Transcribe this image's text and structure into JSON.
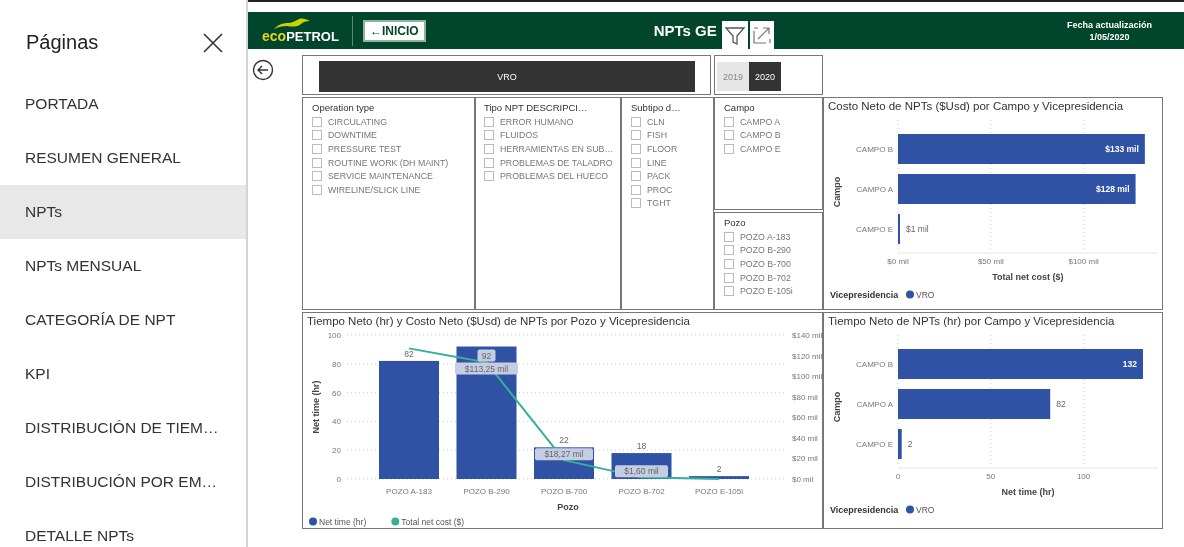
{
  "sidebar": {
    "title": "Páginas",
    "items": [
      {
        "label": "PORTADA",
        "selected": false
      },
      {
        "label": "RESUMEN GENERAL",
        "selected": false
      },
      {
        "label": "NPTs",
        "selected": true
      },
      {
        "label": "NPTs MENSUAL",
        "selected": false
      },
      {
        "label": "CATEGORÍA DE NPT",
        "selected": false
      },
      {
        "label": "KPI",
        "selected": false
      },
      {
        "label": "DISTRIBUCIÓN DE TIEM…",
        "selected": false
      },
      {
        "label": "DISTRIBUCIÓN POR EM…",
        "selected": false
      },
      {
        "label": "DETALLE NPTs",
        "selected": false
      }
    ]
  },
  "header": {
    "logo": {
      "lead": "eco",
      "rest": "PETROL"
    },
    "home_button": "←INICIO",
    "title": "NPTs GE",
    "update_label": "Fecha actualización",
    "update_date": "1/05/2020"
  },
  "vp_slicer": {
    "items": [
      {
        "label": "VRO",
        "selected": true
      }
    ]
  },
  "year_slicer": {
    "items": [
      {
        "label": "2019",
        "selected": false
      },
      {
        "label": "2020",
        "selected": true
      }
    ]
  },
  "slicers": [
    {
      "title": "Operation type",
      "items": [
        {
          "label": "CIRCULATING",
          "checked": false
        },
        {
          "label": "DOWNTIME",
          "checked": false
        },
        {
          "label": "PRESSURE TEST",
          "checked": false
        },
        {
          "label": "ROUTINE WORK (DH MAINT)",
          "checked": false
        },
        {
          "label": "SERVICE MAINTENANCE",
          "checked": false
        },
        {
          "label": "WIRELINE/SLICK LINE",
          "checked": false
        }
      ]
    },
    {
      "title": "Tipo NPT DESCRIPCI…",
      "items": [
        {
          "label": "ERROR HUMANO",
          "checked": false
        },
        {
          "label": "FLUIDOS",
          "checked": false
        },
        {
          "label": "HERRAMIENTAS EN SUB…",
          "checked": false
        },
        {
          "label": "PROBLEMAS DE TALADRO",
          "checked": false
        },
        {
          "label": "PROBLEMAS DEL HUECO",
          "checked": false
        }
      ]
    },
    {
      "title": "Subtipo d…",
      "items": [
        {
          "label": "CLN",
          "checked": false
        },
        {
          "label": "FISH",
          "checked": false
        },
        {
          "label": "FLOOR",
          "checked": false
        },
        {
          "label": "LINE",
          "checked": false
        },
        {
          "label": "PACK",
          "checked": false
        },
        {
          "label": "PROC",
          "checked": false
        },
        {
          "label": "TGHT",
          "checked": false
        }
      ]
    },
    {
      "title": "Campo",
      "items": [
        {
          "label": "CAMPO A",
          "checked": false
        },
        {
          "label": "CAMPO B",
          "checked": false
        },
        {
          "label": "CAMPO E",
          "checked": false
        }
      ]
    },
    {
      "title": "Pozo",
      "items": [
        {
          "label": "POZO A-183",
          "checked": false
        },
        {
          "label": "POZO B-290",
          "checked": false
        },
        {
          "label": "POZO B-700",
          "checked": false
        },
        {
          "label": "POZO B-702",
          "checked": false
        },
        {
          "label": "POZO E-105i",
          "checked": false
        }
      ]
    }
  ],
  "cost_chart": {
    "chart_data": {
      "type": "bar",
      "orientation": "horizontal",
      "title": "Costo Neto de NPTs ($Usd) por Campo y Vicepresidencia",
      "xlabel": "Total net cost ($)",
      "ylabel": "Campo",
      "legend_title": "Vicepresidencia",
      "categories": [
        "CAMPO B",
        "CAMPO A",
        "CAMPO E"
      ],
      "series": [
        {
          "name": "VRO",
          "color": "#2f52a5",
          "values": [
            133,
            128,
            1
          ],
          "value_labels": [
            "$133 mil",
            "$128 mil",
            "$1 mil"
          ]
        }
      ],
      "legend": true,
      "grid": true,
      "xlim": [
        0,
        140
      ],
      "xticks": [
        {
          "value": 0,
          "label": "$0 mil"
        },
        {
          "value": 50,
          "label": "$50 mil"
        },
        {
          "value": 100,
          "label": "$100 mil"
        }
      ]
    }
  },
  "combo_chart": {
    "chart_data": {
      "type": "bar",
      "title": "Tiempo Neto (hr) y Costo Neto ($Usd) de NPTs por Pozo y Vicepresidencia",
      "xlabel": "Pozo",
      "ylabel": "Net time (hr)",
      "categories": [
        "POZO A-183",
        "POZO B-290",
        "POZO B-700",
        "POZO B-702",
        "POZO E-105i"
      ],
      "series": [
        {
          "name": "Net time (hr)",
          "type": "bar",
          "color": "#2f52a5",
          "values": [
            82,
            92,
            22,
            18,
            2
          ],
          "value_labels": [
            "82",
            "92",
            "22",
            "18",
            "2"
          ]
        },
        {
          "name": "Total net cost ($)",
          "type": "line",
          "axis": "y2",
          "color": "#35b09a",
          "values": [
            127,
            113.25,
            18.27,
            1.6,
            0
          ],
          "value_labels": [
            null,
            "$113,25 mil",
            "$18,27 mil",
            "$1,60 mil",
            null
          ]
        }
      ],
      "legend": true,
      "grid": true,
      "ylim": [
        0,
        100
      ],
      "yticks": [
        0,
        20,
        40,
        60,
        80,
        100
      ],
      "y2lim": [
        0,
        140
      ],
      "y2ticks": [
        {
          "value": 0,
          "label": "$0 mil"
        },
        {
          "value": 20,
          "label": "$20 mil"
        },
        {
          "value": 40,
          "label": "$40 mil"
        },
        {
          "value": 60,
          "label": "$60 mil"
        },
        {
          "value": 80,
          "label": "$80 mil"
        },
        {
          "value": 100,
          "label": "$100 mil"
        },
        {
          "value": 120,
          "label": "$120 mil"
        },
        {
          "value": 140,
          "label": "$140 mil"
        }
      ]
    }
  },
  "time_chart": {
    "chart_data": {
      "type": "bar",
      "orientation": "horizontal",
      "title": "Tiempo Neto de NPTs (hr) por Campo y Vicepresidencia",
      "xlabel": "Net time (hr)",
      "ylabel": "Campo",
      "legend_title": "Vicepresidencia",
      "categories": [
        "CAMPO B",
        "CAMPO A",
        "CAMPO E"
      ],
      "series": [
        {
          "name": "VRO",
          "color": "#2f52a5",
          "values": [
            132,
            82,
            2
          ],
          "value_labels": [
            "132",
            "82",
            "2"
          ]
        }
      ],
      "legend": true,
      "grid": true,
      "xlim": [
        0,
        140
      ],
      "xticks": [
        0,
        50,
        100
      ]
    }
  }
}
